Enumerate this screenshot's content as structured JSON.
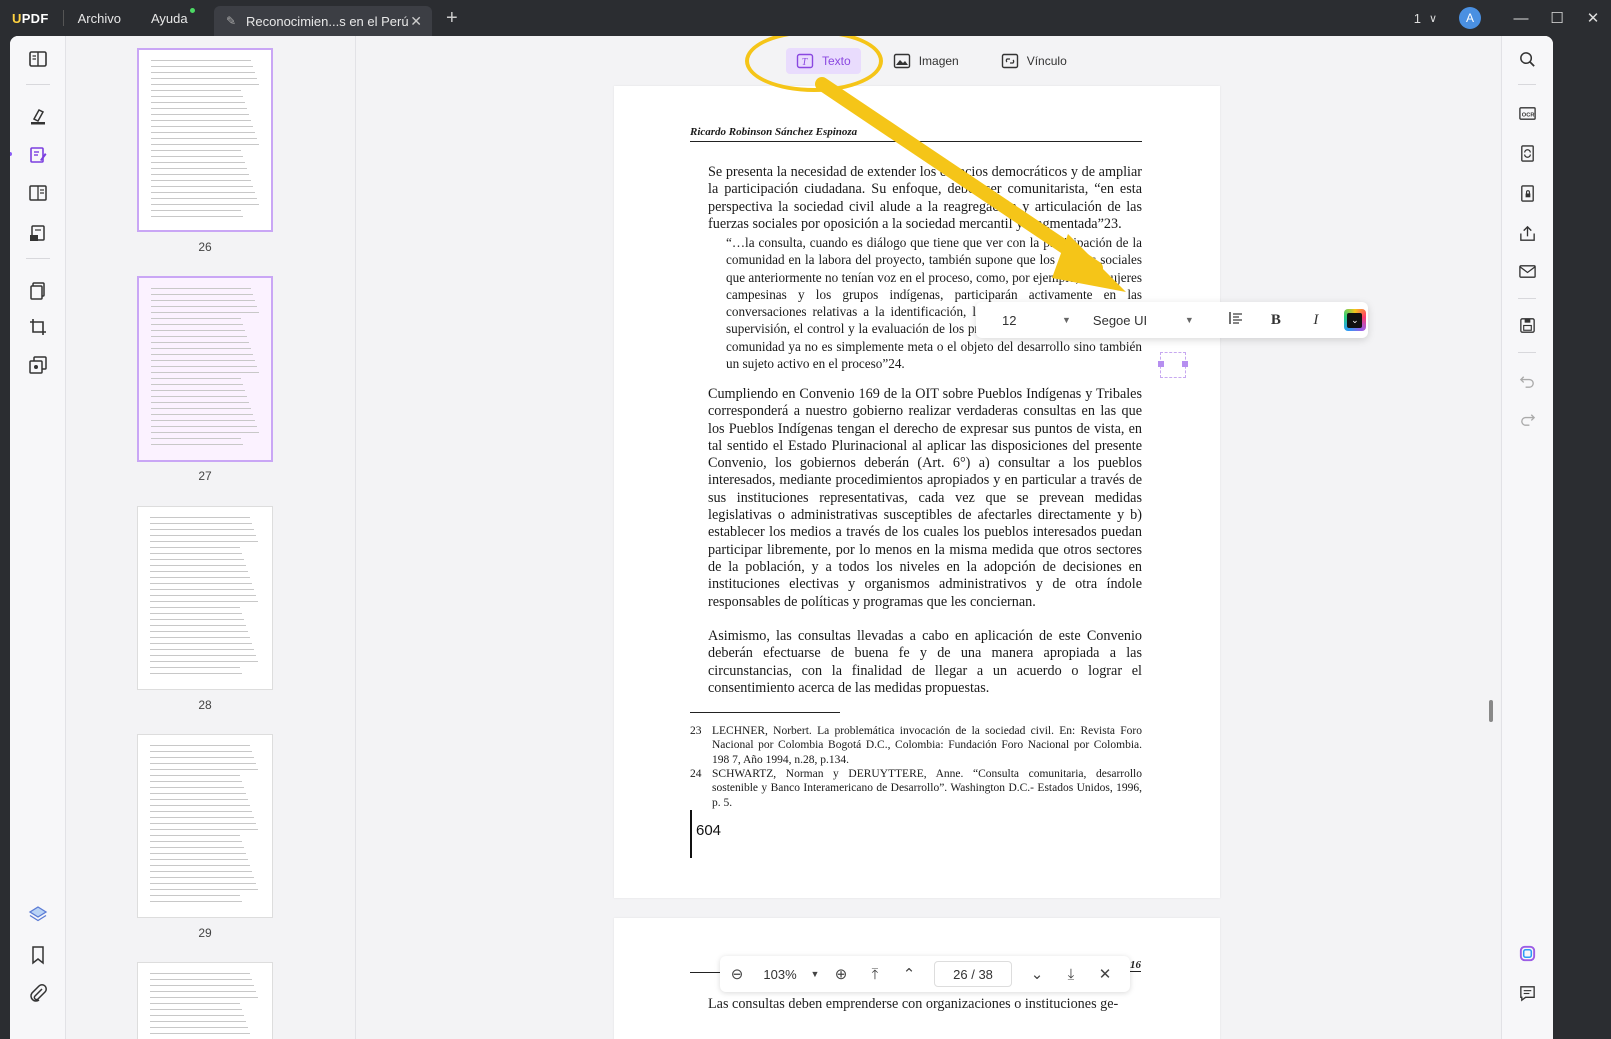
{
  "app": {
    "logo": "UPDF",
    "menus": [
      "Archivo",
      "Ayuda"
    ],
    "tab_title": "Reconocimien...s en el Perú",
    "window_count": "1",
    "avatar_letter": "A"
  },
  "edit_toolbar": {
    "text_label": "Texto",
    "image_label": "Imagen",
    "link_label": "Vínculo"
  },
  "thumbnails": {
    "pages": [
      "26",
      "27",
      "28",
      "29"
    ]
  },
  "document": {
    "running_head": "Ricardo Robinson Sánchez Espinoza",
    "para1": "Se presenta la necesidad de extender los espacios democráticos y de ampliar la participación ciudadana. Su enfoque, deber ser comunitarista, “en esta perspectiva la sociedad civil alude a la reagregación y articulación de las fuerzas sociales por oposición a la sociedad mercantil y fragmentada”23.",
    "quote": "“…la consulta, cuando es diálogo que tiene que ver con la participación de la comunidad en la labora del proyecto, también supone que los actores sociales que anteriormente no tenían voz en el proceso, como, por ejemplo, las mujeres campesinas y los grupos indígenas, participarán activamente en las conversaciones relativas a la identificación, la concepción, la ejecución, la supervisión, el control y la evaluación de los proyectos. La participación de la comunidad ya no es simplemente meta o el objeto del desarrollo sino también un sujeto activo en el proceso”24.",
    "para2": "Cumpliendo en Convenio 169 de la OIT sobre Pueblos Indígenas y Tribales corresponderá a nuestro gobierno realizar verdaderas consultas en las que los Pueblos Indígenas tengan el derecho de expresar sus puntos de vista, en tal sentido el Estado Plurinacional al aplicar las disposiciones del presente Convenio, los gobiernos deberán (Art. 6°) a) consultar a los pueblos interesados, mediante procedimientos apropiados y en particular a través de sus instituciones representativas, cada vez que se prevean medidas legislativas o administrativas susceptibles de afectarles directamente y b) establecer los medios a través de los cuales los pueblos interesados puedan participar libremente, por lo menos en la misma medida que otros sectores de la población, y a todos los niveles en la adopción de decisiones en instituciones electivas y organismos administrativos y de otra índole responsables de políticas y programas que les conciernan.",
    "para3": "Asimismo, las consultas llevadas a cabo en aplicación de este Convenio deberán efectuarse de buena fe y de una manera apropiada a las circunstancias, con la finalidad de llegar a un acuerdo o lograr el consentimiento acerca de las medidas propuestas.",
    "fn23_num": "23",
    "fn23_text": "LECHNER, Norbert. La problemática invocación de la sociedad civil. En: Revista Foro Nacional por Colombia Bogotá D.C., Colombia: Fundación Foro Nacional por Colombia. 198 7, Año 1994, n.28, p.134.",
    "fn24_num": "24",
    "fn24_text": "SCHWARTZ, Norman y DERUYTTERE, Anne. “Consulta comunitaria, desarrollo sostenible y Banco Interamericano de Desarrollo”. Washington D.C.- Estados Unidos, 1996, p. 5.",
    "page_number": "604",
    "next_page_head_num": "16",
    "next_page_text": "Las consultas deben emprenderse con organizaciones o instituciones ge-"
  },
  "format_bar": {
    "font_size": "12",
    "font_family": "Segoe UI",
    "bold": "B",
    "italic": "I"
  },
  "bottom_nav": {
    "zoom": "103%",
    "current_page": "26",
    "total_pages": "38",
    "separator": "/"
  },
  "colors": {
    "accent": "#8a47e0",
    "highlight": "#f5c518"
  }
}
